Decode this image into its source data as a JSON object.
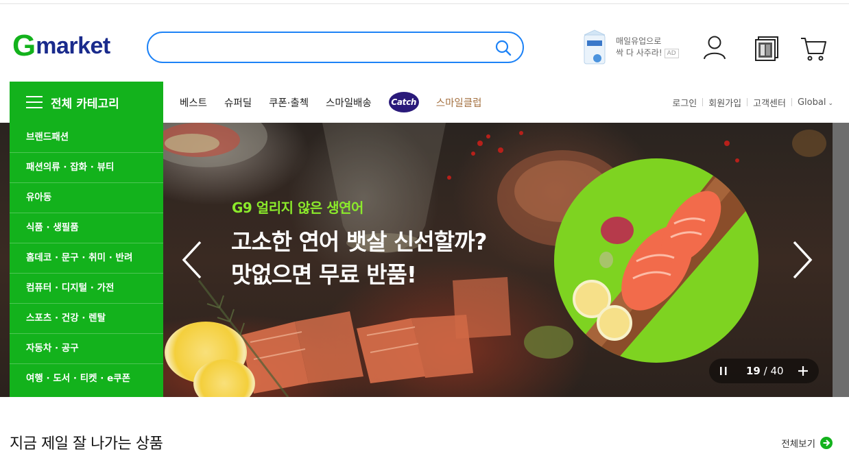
{
  "logo": {
    "g": "G",
    "rest": "market"
  },
  "search": {
    "placeholder": "",
    "value": ""
  },
  "ad": {
    "line1": "매일유업으로",
    "line2": "싹 다 사주라!",
    "badge": "AD"
  },
  "nav": {
    "category_button": "전체 카테고리",
    "links": [
      "베스트",
      "슈퍼딜",
      "쿠폰·출첵",
      "스마일배송"
    ],
    "catch_logo": "Catch",
    "smile_club": "스마일클럽",
    "util": [
      "로그인",
      "회원가입",
      "고객센터",
      "Global"
    ]
  },
  "categories": [
    "브랜드패션",
    "패션의류 · 잡화 · 뷰티",
    "유아동",
    "식품 · 생필품",
    "홈데코 · 문구 · 취미 · 반려",
    "컴퓨터 · 디지털 · 가전",
    "스포츠 · 건강 · 렌탈",
    "자동차 · 공구",
    "여행 · 도서 · 티켓 · e쿠폰"
  ],
  "hero": {
    "subtitle": "G9 얼리지 않은 생연어",
    "title_line1": "고소한 연어 뱃살 신선할까?",
    "title_line2": "맛없으면 무료 반품!",
    "current": "19",
    "total": "/ 40"
  },
  "section": {
    "title": "지금 제일 잘 나가는 상품",
    "view_all": "전체보기"
  },
  "colors": {
    "brand_green": "#13b21c",
    "brand_navy": "#1a2b8c",
    "search_blue": "#1d82f6",
    "hero_accent": "#8bea2b"
  }
}
